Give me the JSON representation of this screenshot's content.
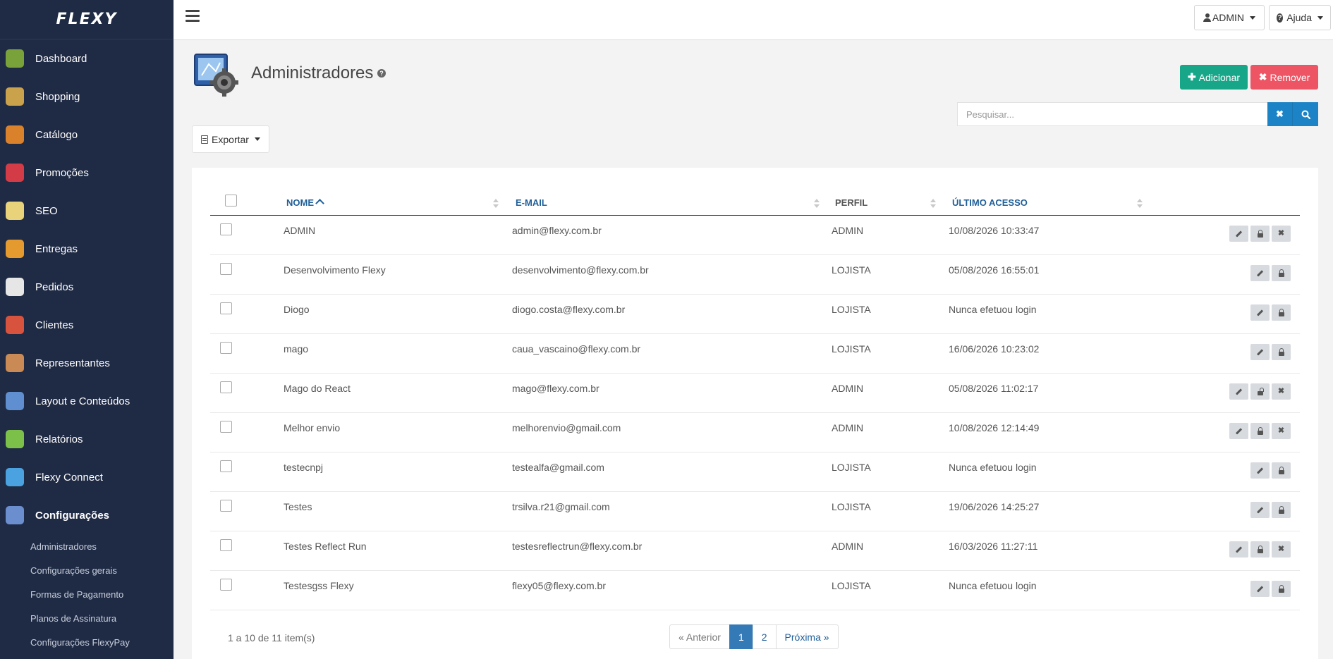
{
  "app": {
    "logo": "FLEXY"
  },
  "sidebar": {
    "items": [
      {
        "label": "Dashboard",
        "icon": "dashboard-icon",
        "color": "#7aa23a"
      },
      {
        "label": "Shopping",
        "icon": "shopping-icon",
        "color": "#c9a24b"
      },
      {
        "label": "Catálogo",
        "icon": "catalog-icon",
        "color": "#d9822b"
      },
      {
        "label": "Promoções",
        "icon": "promotions-icon",
        "color": "#d33b47"
      },
      {
        "label": "SEO",
        "icon": "seo-icon",
        "color": "#e8d27a"
      },
      {
        "label": "Entregas",
        "icon": "delivery-icon",
        "color": "#e59a2f"
      },
      {
        "label": "Pedidos",
        "icon": "orders-icon",
        "color": "#e6e6e6"
      },
      {
        "label": "Clientes",
        "icon": "clients-icon",
        "color": "#d8533e"
      },
      {
        "label": "Representantes",
        "icon": "representatives-icon",
        "color": "#c98a56"
      },
      {
        "label": "Layout e Conteúdos",
        "icon": "layout-icon",
        "color": "#5f8fd0"
      },
      {
        "label": "Relatórios",
        "icon": "reports-icon",
        "color": "#7cc04a"
      },
      {
        "label": "Flexy Connect",
        "icon": "share-icon",
        "color": "#4aa3e0"
      },
      {
        "label": "Configurações",
        "icon": "settings-icon",
        "color": "#6b8ecf"
      }
    ],
    "subitems": [
      {
        "label": "Administradores"
      },
      {
        "label": "Configurações gerais"
      },
      {
        "label": "Formas de Pagamento"
      },
      {
        "label": "Planos de Assinatura"
      },
      {
        "label": "Configurações FlexyPay"
      }
    ]
  },
  "topbar": {
    "user_label": "ADMIN",
    "help_label": "Ajuda"
  },
  "page": {
    "title": "Administradores"
  },
  "toolbar": {
    "add_label": "Adicionar",
    "remove_label": "Remover",
    "export_label": "Exportar"
  },
  "search": {
    "placeholder": "Pesquisar...",
    "value": ""
  },
  "table": {
    "columns": {
      "name": "NOME",
      "email": "E-MAIL",
      "profile": "PERFIL",
      "last_access": "ÚLTIMO ACESSO"
    },
    "rows": [
      {
        "name": "ADMIN",
        "email": "admin@flexy.com.br",
        "profile": "ADMIN",
        "last_access": "10/08/2026 10:33:47",
        "actions": [
          "edit",
          "lock",
          "delete"
        ]
      },
      {
        "name": "Desenvolvimento Flexy",
        "email": "desenvolvimento@flexy.com.br",
        "profile": "LOJISTA",
        "last_access": "05/08/2026 16:55:01",
        "actions": [
          "edit",
          "lock"
        ]
      },
      {
        "name": "Diogo",
        "email": "diogo.costa@flexy.com.br",
        "profile": "LOJISTA",
        "last_access": "Nunca efetuou login",
        "actions": [
          "edit",
          "lock"
        ]
      },
      {
        "name": "mago",
        "email": "caua_vascaino@flexy.com.br",
        "profile": "LOJISTA",
        "last_access": "16/06/2026 10:23:02",
        "actions": [
          "edit",
          "lock"
        ]
      },
      {
        "name": "Mago do React",
        "email": "mago@flexy.com.br",
        "profile": "ADMIN",
        "last_access": "05/08/2026 11:02:17",
        "actions": [
          "edit",
          "unlock",
          "delete"
        ]
      },
      {
        "name": "Melhor envio",
        "email": "melhorenvio@gmail.com",
        "profile": "ADMIN",
        "last_access": "10/08/2026 12:14:49",
        "actions": [
          "edit",
          "lock",
          "delete"
        ]
      },
      {
        "name": "testecnpj",
        "email": "testealfa@gmail.com",
        "profile": "LOJISTA",
        "last_access": "Nunca efetuou login",
        "actions": [
          "edit",
          "lock"
        ]
      },
      {
        "name": "Testes",
        "email": "trsilva.r21@gmail.com",
        "profile": "LOJISTA",
        "last_access": "19/06/2026 14:25:27",
        "actions": [
          "edit",
          "lock"
        ]
      },
      {
        "name": "Testes Reflect Run",
        "email": "testesreflectrun@flexy.com.br",
        "profile": "ADMIN",
        "last_access": "16/03/2026 11:27:11",
        "actions": [
          "edit",
          "lock",
          "delete"
        ]
      },
      {
        "name": "Testesgss Flexy",
        "email": "flexy05@flexy.com.br",
        "profile": "LOJISTA",
        "last_access": "Nunca efetuou login",
        "actions": [
          "edit",
          "lock"
        ]
      }
    ]
  },
  "footer": {
    "count_text": "1 a 10 de 11 item(s)"
  },
  "pagination": {
    "prev_label": "« Anterior",
    "pages": [
      "1",
      "2"
    ],
    "current": "1",
    "next_label": "Próxima »"
  }
}
